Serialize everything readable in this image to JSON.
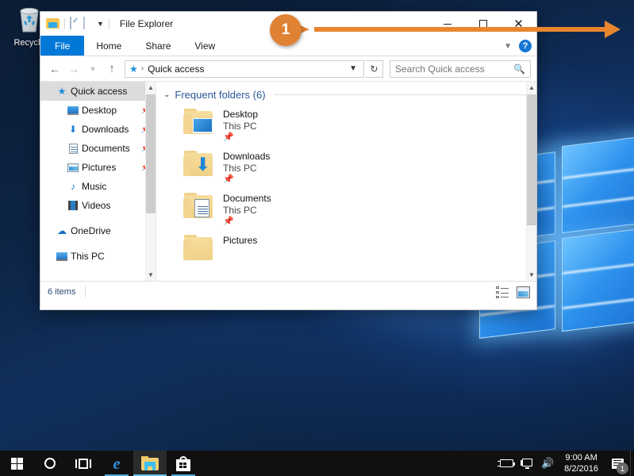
{
  "desktop": {
    "recycle_bin": {
      "label": "Recycle",
      "icon": "recycle-bin-icon"
    }
  },
  "window": {
    "title": "File Explorer",
    "quick_access_toolbar": [
      {
        "icon": "folder-icon",
        "name": "explorer-icon"
      },
      {
        "icon": "properties-icon",
        "name": "properties-button"
      },
      {
        "icon": "new-folder-icon",
        "name": "new-folder-button"
      },
      {
        "icon": "chevron-down-icon",
        "name": "customize-qat-button"
      }
    ],
    "controls": {
      "minimize": "minimize-button",
      "maximize": "maximize-button",
      "close": "close-button"
    },
    "ribbon": {
      "tabs": [
        {
          "label": "File",
          "active": true
        },
        {
          "label": "Home",
          "active": false
        },
        {
          "label": "Share",
          "active": false
        },
        {
          "label": "View",
          "active": false
        }
      ],
      "collapse_icon": "chevron-down-icon",
      "help_label": "?"
    },
    "navigation": {
      "back": "back-icon",
      "forward": "forward-icon",
      "recent": "recent-locations-icon",
      "up": "up-icon",
      "address": {
        "icon": "quick-access-star-icon",
        "separator": "›",
        "path": "Quick access",
        "dropdown_icon": "chevron-down-icon"
      },
      "refresh_icon": "refresh-icon",
      "search": {
        "placeholder": "Search Quick access",
        "value": "",
        "icon": "search-icon"
      }
    },
    "sidebar": {
      "items": [
        {
          "label": "Quick access",
          "icon": "quick-access-star-icon",
          "level": 0,
          "selected": true,
          "pinned": false
        },
        {
          "label": "Desktop",
          "icon": "desktop-monitor-icon",
          "level": 1,
          "selected": false,
          "pinned": true
        },
        {
          "label": "Downloads",
          "icon": "download-arrow-icon",
          "level": 1,
          "selected": false,
          "pinned": true
        },
        {
          "label": "Documents",
          "icon": "document-icon",
          "level": 1,
          "selected": false,
          "pinned": true
        },
        {
          "label": "Pictures",
          "icon": "picture-icon",
          "level": 1,
          "selected": false,
          "pinned": true
        },
        {
          "label": "Music",
          "icon": "music-note-icon",
          "level": 1,
          "selected": false,
          "pinned": false
        },
        {
          "label": "Videos",
          "icon": "video-film-icon",
          "level": 1,
          "selected": false,
          "pinned": false
        },
        {
          "label": "OneDrive",
          "icon": "cloud-icon",
          "level": 0,
          "selected": false,
          "pinned": false
        },
        {
          "label": "This PC",
          "icon": "this-pc-icon",
          "level": 0,
          "selected": false,
          "pinned": false
        }
      ],
      "pin_glyph": "📌"
    },
    "content": {
      "group_title": "Frequent folders (6)",
      "group_chevron": "chevron-down-icon",
      "folders": [
        {
          "name": "Desktop",
          "location": "This PC",
          "icon": "folder-desktop-icon",
          "pinned": true
        },
        {
          "name": "Downloads",
          "location": "This PC",
          "icon": "folder-downloads-icon",
          "pinned": true
        },
        {
          "name": "Documents",
          "location": "This PC",
          "icon": "folder-documents-icon",
          "pinned": true
        },
        {
          "name": "Pictures",
          "location": "",
          "icon": "folder-pictures-icon",
          "pinned": false
        }
      ]
    },
    "status_bar": {
      "item_count": "6 items",
      "view_details": "details-view-button",
      "view_icons": "large-icons-view-button"
    }
  },
  "callout": {
    "number": "1",
    "accent_color": "#e8862f"
  },
  "taskbar": {
    "items": [
      {
        "name": "start-button",
        "icon": "windows-logo-icon",
        "active": false,
        "running": false
      },
      {
        "name": "cortana-search-button",
        "icon": "cortana-circle-icon",
        "active": false,
        "running": false
      },
      {
        "name": "task-view-button",
        "icon": "task-view-icon",
        "active": false,
        "running": false
      },
      {
        "name": "edge-button",
        "icon": "edge-icon",
        "active": false,
        "running": true
      },
      {
        "name": "file-explorer-button",
        "icon": "folder-icon",
        "active": true,
        "running": true
      },
      {
        "name": "store-button",
        "icon": "store-bag-icon",
        "active": false,
        "running": true
      }
    ],
    "tray": {
      "battery_icon": "battery-charging-icon",
      "network_icon": "network-icon",
      "volume_icon": "volume-icon",
      "volume_glyph": "🔊",
      "time": "9:00 AM",
      "date": "8/2/2016",
      "action_center_icon": "action-center-icon",
      "notification_count": "1"
    }
  }
}
